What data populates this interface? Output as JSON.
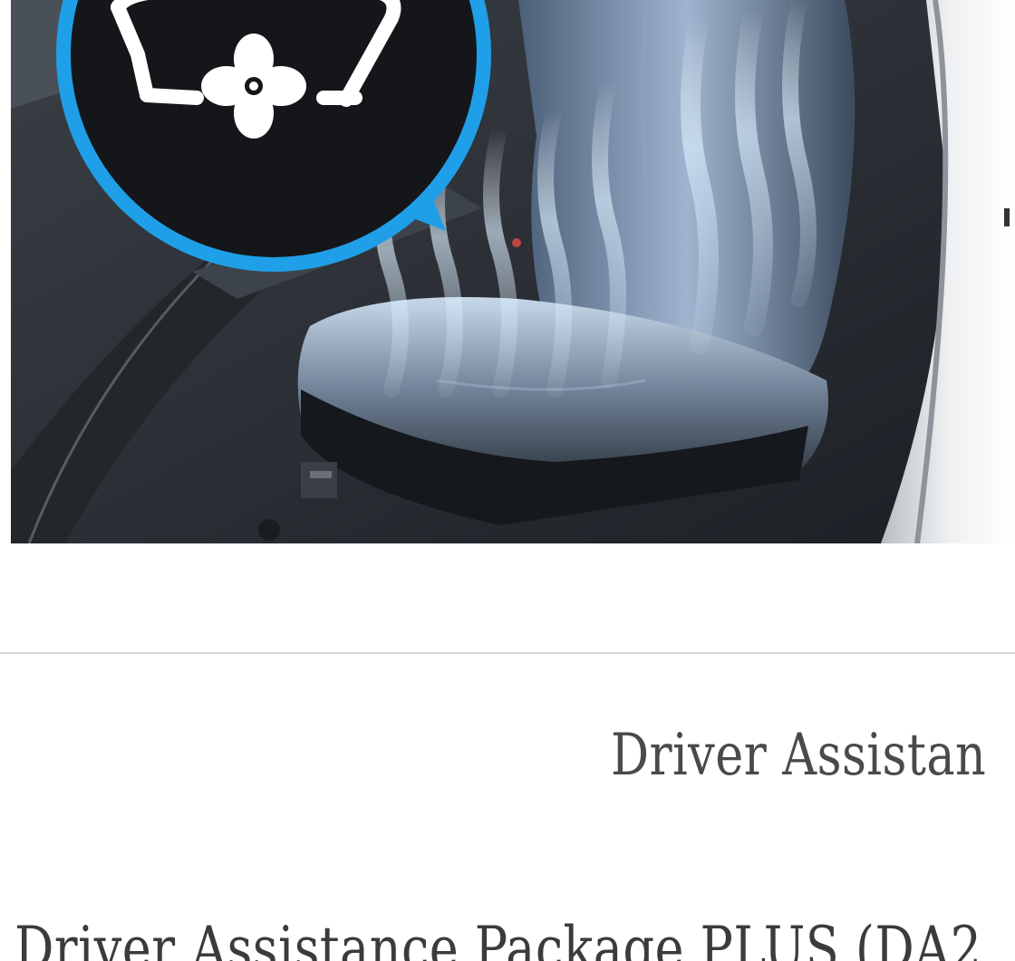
{
  "image": {
    "subject": "ventilated-seat",
    "icon": "seat-ventilation-fan-icon",
    "colors": {
      "accent_blue": "#1f9fe8",
      "interior_dark": "#2c3036",
      "airflow": "#d9ecff"
    }
  },
  "section": {
    "heading": "Driver Assistan"
  },
  "package": {
    "title": "Driver Assistance Package PLUS (DA2"
  }
}
